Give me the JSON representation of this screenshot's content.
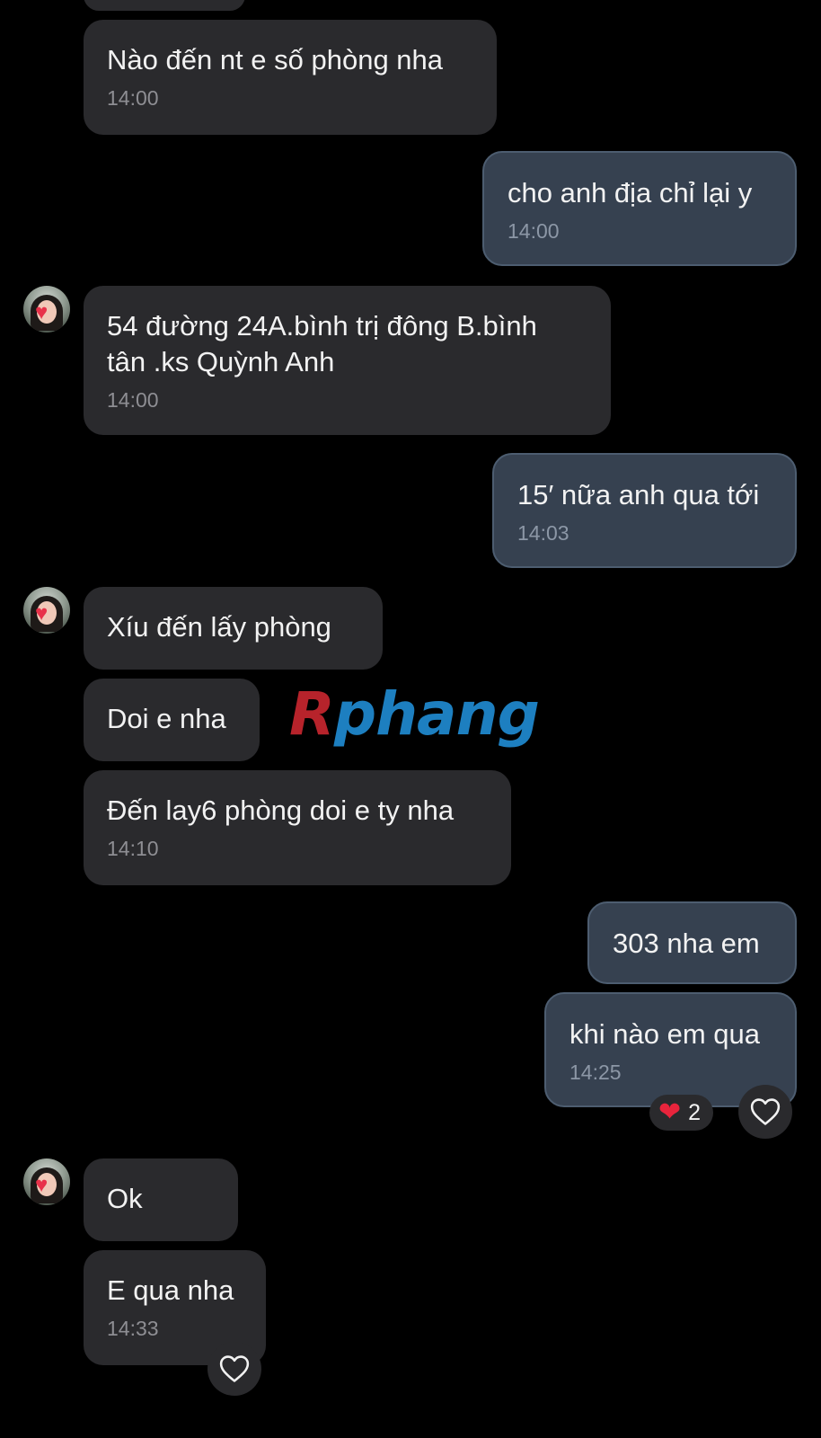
{
  "watermark": {
    "first": "R",
    "rest": "phang"
  },
  "messages": [
    {
      "direction": "incoming",
      "text": "Nào đến nt e số phòng nha",
      "time": "14:00"
    },
    {
      "direction": "outgoing",
      "text": "cho anh địa chỉ lại y",
      "time": "14:00"
    },
    {
      "direction": "incoming",
      "text": "54 đường 24A.bình trị đông B.bình\ntân .ks Quỳnh Anh",
      "time": "14:00"
    },
    {
      "direction": "outgoing",
      "text": "15′ nữa anh qua tới",
      "time": "14:03"
    },
    {
      "direction": "incoming",
      "text": "Xíu đến lấy phòng",
      "time": ""
    },
    {
      "direction": "incoming",
      "text": "Doi e nha",
      "time": ""
    },
    {
      "direction": "incoming",
      "text": "Đến lay6 phòng doi e ty nha",
      "time": "14:10"
    },
    {
      "direction": "outgoing",
      "text": "303 nha em",
      "time": ""
    },
    {
      "direction": "outgoing",
      "text": "khi nào em qua",
      "time": "14:25"
    },
    {
      "direction": "incoming",
      "text": "Ok",
      "time": ""
    },
    {
      "direction": "incoming",
      "text": "E qua nha",
      "time": "14:33"
    }
  ],
  "reactions": {
    "msg8": {
      "emoji": "heart",
      "count": "2"
    }
  },
  "icons": {
    "like": "heart-outline-icon",
    "reaction": "red-heart-emoji"
  },
  "colors": {
    "background": "#000000",
    "incoming_bubble": "#2a2a2d",
    "outgoing_bubble": "#364150",
    "outgoing_border": "#4d5d70",
    "timestamp": "#8e8e93"
  }
}
